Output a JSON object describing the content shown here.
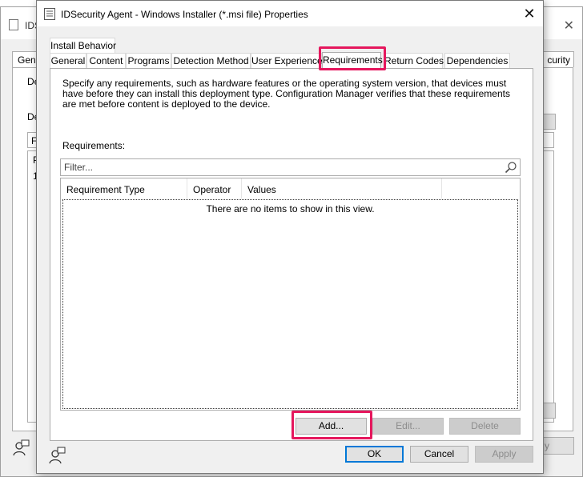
{
  "background_window": {
    "title_fragment": "IDS",
    "left_tab_fragment": "Gene",
    "right_tab_fragment": "curity",
    "label_fragment_1": "De",
    "label_fragment_2": "De",
    "input_fragment": "Fi",
    "row_fragment_1": "P",
    "row_fragment_2": "1",
    "button_fragment": "y"
  },
  "dialog": {
    "title": "IDSecurity Agent - Windows Installer (*.msi file) Properties",
    "tabs_row2": [
      "Install Behavior"
    ],
    "tabs_row1": [
      "General",
      "Content",
      "Programs",
      "Detection Method",
      "User Experience",
      "Requirements",
      "Return Codes",
      "Dependencies"
    ],
    "active_tab": "Requirements",
    "highlight_color": "#e5175d",
    "description": "Specify any requirements, such as hardware features or the operating system version, that devices must have before they can install this deployment type. Configuration Manager verifies that these requirements are met before content is deployed to the device.",
    "requirements_label": "Requirements:",
    "filter_placeholder": "Filter...",
    "columns": [
      "Requirement Type",
      "Operator",
      "Values"
    ],
    "empty_message": "There are no items to show in this view.",
    "buttons": {
      "add": "Add...",
      "edit": "Edit...",
      "delete": "Delete",
      "ok": "OK",
      "cancel": "Cancel",
      "apply": "Apply"
    }
  }
}
